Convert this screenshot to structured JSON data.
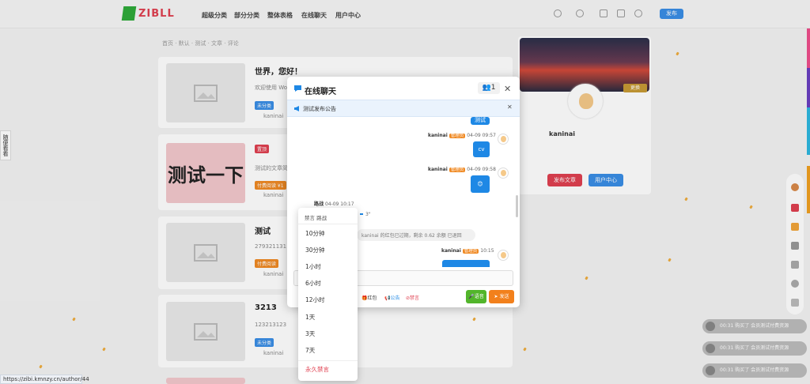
{
  "site": {
    "logo_text": "ZIBLL"
  },
  "nav": [
    "超级分类",
    "部分分类",
    "整体表格",
    "在线聊天",
    "用户中心"
  ],
  "publish_label": "发布",
  "breadcrumb": "首页 · 默认 · 测试 · 文章 · 评论",
  "float_tab": "随便看看",
  "posts": [
    {
      "title": "世界，您好！",
      "sub": "欢迎使用 WordPress",
      "tag": "未分类",
      "author": "kaninai"
    },
    {
      "title": "测试一下",
      "thumb_text": "测试一下",
      "tag": "置顶",
      "sub": "测试的文章简介",
      "tag2": "付费阅读 ¥1",
      "author": "kaninai"
    },
    {
      "title": "测试",
      "sub": "279321131",
      "tag": "付费阅读",
      "author": "kaninai"
    },
    {
      "title": "3213",
      "sub": "123213123",
      "tag": "未分类",
      "author": "kaninai"
    }
  ],
  "profile": {
    "name": "kaninai",
    "btn_left": "发布文章",
    "btn_right": "用户中心",
    "cover_label": "更换"
  },
  "chat": {
    "title": "在线聊天",
    "online_count": "1",
    "notice": "测试发布公告",
    "messages": [
      {
        "user": "kaninai",
        "role": "管理员",
        "time": "04-09 09:57",
        "text": "cv"
      },
      {
        "user": "kaninai",
        "role": "管理员",
        "time": "04-09 09:58",
        "text": "😊"
      },
      {
        "user": "路战",
        "time": "04-09 10:17",
        "text": "3\""
      },
      {
        "system": "kaninai 的红包已过期，剩余 0.62 余额 已退回"
      },
      {
        "user": "kaninai",
        "role": "管理员",
        "time": "10:15"
      }
    ],
    "top_bubble": "测试",
    "tools": [
      "红包",
      "公告",
      "禁言"
    ],
    "voice_label": "语音",
    "send_label": "发送"
  },
  "mute_menu": {
    "header": "禁言 路战",
    "options": [
      "10分钟",
      "30分钟",
      "1小时",
      "6小时",
      "12小时",
      "1天",
      "3天",
      "7天"
    ],
    "permanent": "永久禁言"
  },
  "toasts": [
    "00:31 购买了 会员测试付费资源",
    "00:31 购买了 会员测试付费资源",
    "00:31 购买了 会员测试付费资源"
  ],
  "status_url": "https://zibi.kmnzy.cn/author/44"
}
